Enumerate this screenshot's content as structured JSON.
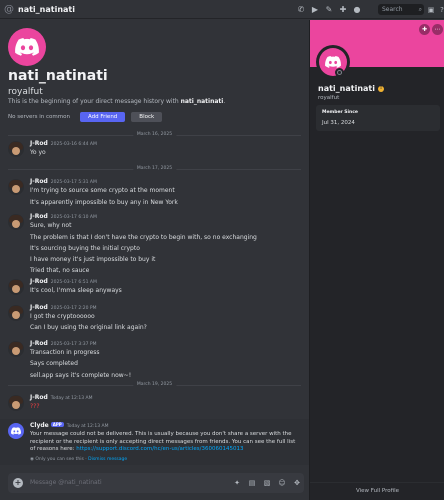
{
  "header": {
    "at_symbol": "@",
    "channel_name": "nati_natinati",
    "search_placeholder": "Search",
    "icons": [
      "phone-icon",
      "video-icon",
      "pin-icon",
      "add-friend-icon",
      "profile-icon",
      "inbox-icon",
      "help-icon"
    ]
  },
  "intro": {
    "display_name": "nati_natinati",
    "username": "royalfut",
    "text_prefix": "This is the beginning of your direct message history with ",
    "text_user": "nati_natinati",
    "text_suffix": ".",
    "no_servers": "No servers in common",
    "add_friend_label": "Add Friend",
    "block_label": "Block"
  },
  "dividers": [
    "March 16, 2025",
    "March 17, 2025",
    "March 19, 2025"
  ],
  "messages": [
    {
      "author": "J-Rod",
      "time": "2025-03-16 6:44 AM",
      "lines": [
        "Yo yo"
      ]
    },
    {
      "author": "J-Rod",
      "time": "2025-03-17 5:31 AM",
      "lines": [
        "I'm trying to source some crypto at the moment",
        "It's apparently impossible to buy any in New York"
      ]
    },
    {
      "author": "J-Rod",
      "time": "2025-03-17 6:10 AM",
      "lines": [
        "Sure, why not",
        "The problem is that I don't have the crypto to begin with, so no exchanging",
        "It's sourcing buying the initial crypto",
        "I have money it's just impossible to buy it",
        "Tried that, no sauce"
      ]
    },
    {
      "author": "J-Rod",
      "time": "2025-03-17 6:51 AM",
      "lines": [
        "It's cool, I'mma sleep anyways"
      ]
    },
    {
      "author": "J-Rod",
      "time": "2025-03-17 2:20 PM",
      "lines": [
        "I got the cryptoooooo",
        "Can I buy using the original link again?"
      ]
    },
    {
      "author": "J-Rod",
      "time": "2025-03-17 3:37 PM",
      "lines": [
        "Transaction in progress",
        "Says completed",
        "sell.app says it's complete now~!"
      ]
    },
    {
      "author": "J-Rod",
      "time": "Today at 12:13 AM",
      "lines": [
        "???"
      ]
    }
  ],
  "clyde": {
    "name": "Clyde",
    "badge": "APP",
    "time": "Today at 12:13 AM",
    "body": "Your message could not be delivered. This is usually because you don't share a server with the recipient or the recipient is only accepting direct messages from friends. You can see the full list of reasons here: ",
    "link": "https://support.discord.com/hc/en-us/articles/360060145013",
    "note_prefix": "Only you can see this · ",
    "note_link": "Dismiss message"
  },
  "composer": {
    "placeholder": "Message @nati_natinati",
    "tools": [
      "gift-icon",
      "gif-icon",
      "sticker-icon",
      "emoji-icon",
      "apps-icon"
    ]
  },
  "profile": {
    "display_name": "nati_natinati",
    "username": "royalfut",
    "member_since_label": "Member Since",
    "member_since_value": "Jul 31, 2024",
    "view_full_profile": "View Full Profile"
  },
  "colors": {
    "accent": "#5865f2",
    "banner": "#eb459e",
    "link": "#00a8fc"
  }
}
